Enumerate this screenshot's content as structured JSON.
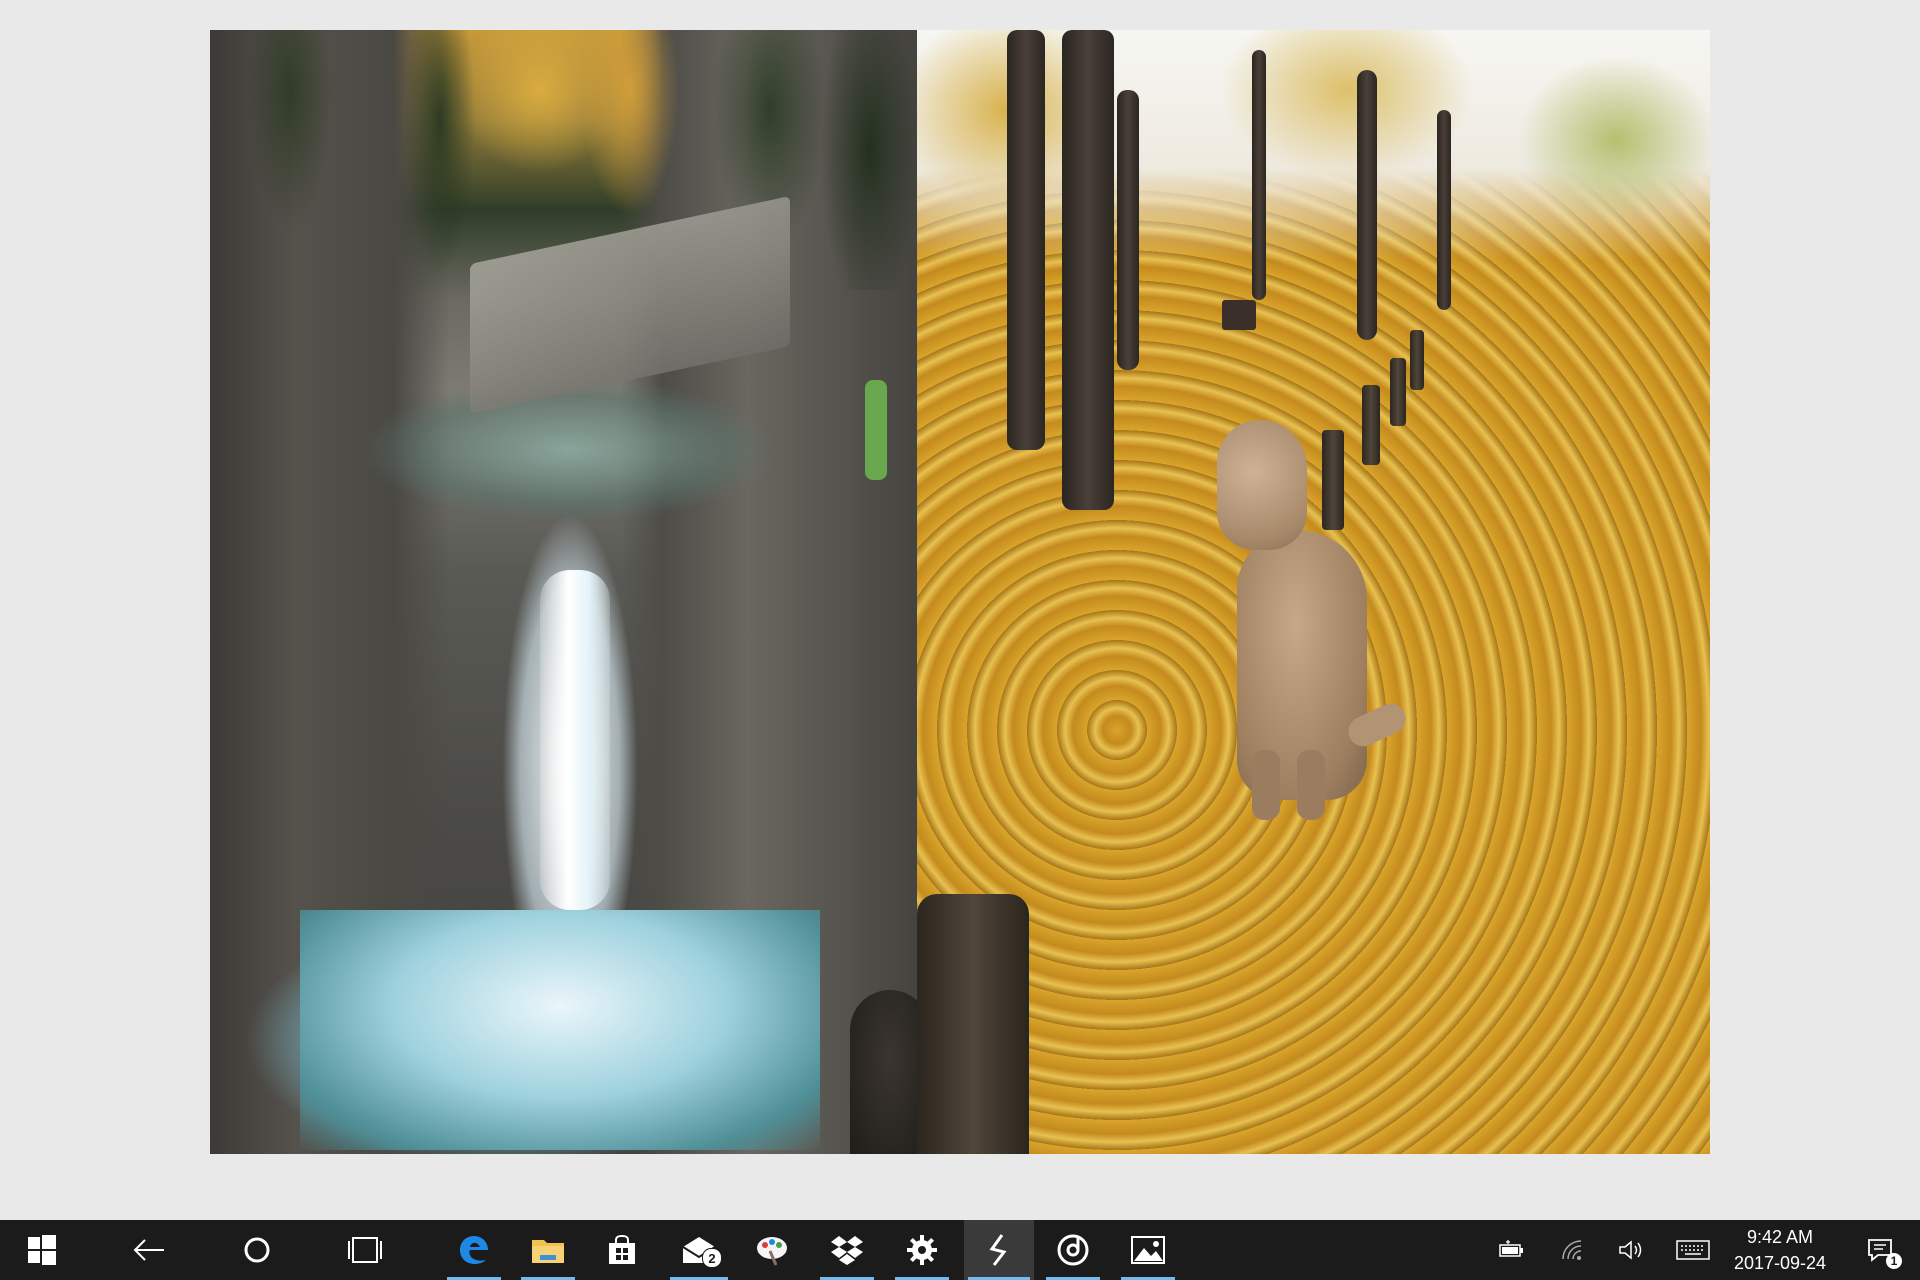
{
  "viewer": {
    "left_photo_desc": "waterfall",
    "right_photo_desc": "dog"
  },
  "taskbar": {
    "start": "start-icon",
    "back": "back-arrow-icon",
    "cortana": "cortana-icon",
    "task_view": "task-view-icon",
    "pinned": [
      {
        "name": "edge-icon",
        "running": true
      },
      {
        "name": "file-explorer-icon",
        "running": true
      },
      {
        "name": "store-icon",
        "running": false
      },
      {
        "name": "mail-icon",
        "running": true,
        "badge": "2"
      },
      {
        "name": "paint-icon",
        "running": false
      },
      {
        "name": "dropbox-icon",
        "running": true
      },
      {
        "name": "settings-icon",
        "running": true
      },
      {
        "name": "app-bolt-icon",
        "running": true,
        "active": true
      },
      {
        "name": "groove-music-icon",
        "running": true
      },
      {
        "name": "photos-icon",
        "running": true
      }
    ],
    "mail_badge": "2",
    "tray": {
      "battery": "battery-icon",
      "wifi": "wifi-icon",
      "volume": "volume-icon",
      "keyboard": "touch-keyboard-icon"
    },
    "clock": {
      "time": "9:42 AM",
      "date": "2017-09-24"
    },
    "notification_count": "1"
  },
  "colors": {
    "taskbar_bg": "#1b1b1b",
    "running_indicator": "#76b9ed",
    "edge_blue": "#1e88e5",
    "explorer_yellow": "#f2c14e"
  }
}
